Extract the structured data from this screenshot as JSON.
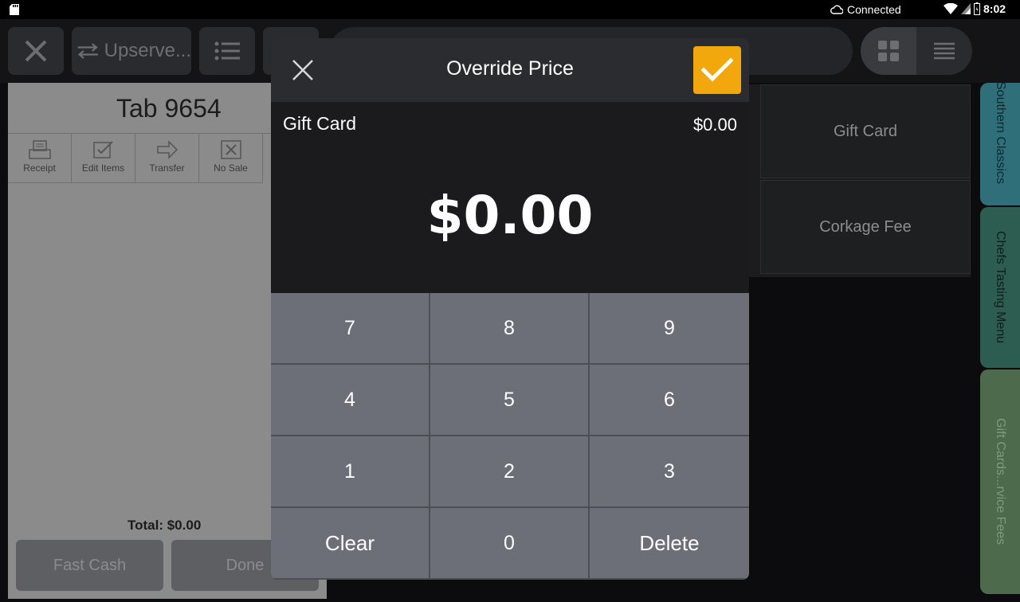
{
  "status_bar": {
    "connection_label": "Connected",
    "time": "8:02"
  },
  "toolbar": {
    "upserve_label": "Upserve..."
  },
  "tab": {
    "title": "Tab 9654",
    "actions": [
      {
        "label": "Receipt",
        "icon": "receipt-icon"
      },
      {
        "label": "Edit Items",
        "icon": "edit-items-icon"
      },
      {
        "label": "Transfer",
        "icon": "transfer-arrow-icon"
      },
      {
        "label": "No Sale",
        "icon": "no-sale-icon"
      }
    ],
    "total": "Total: $0.00",
    "fast_cash_label": "Fast Cash",
    "done_label": "Done"
  },
  "menu_items": [
    "Gift Card",
    "Corkage Fee"
  ],
  "categories": [
    {
      "label": "Southern Classics",
      "color": "#2f6f7a"
    },
    {
      "label": "Chefs Tasting Menu",
      "color": "#2d5d50"
    },
    {
      "label": "Gift Cards...rvice Fees",
      "color": "#4e6a4c"
    }
  ],
  "modal": {
    "title": "Override Price",
    "item_name": "Gift Card",
    "original_price": "$0.00",
    "amount": "$0.00",
    "accent_color": "#f2a70c",
    "keys": [
      "7",
      "8",
      "9",
      "4",
      "5",
      "6",
      "1",
      "2",
      "3",
      "Clear",
      "0",
      "Delete"
    ]
  }
}
